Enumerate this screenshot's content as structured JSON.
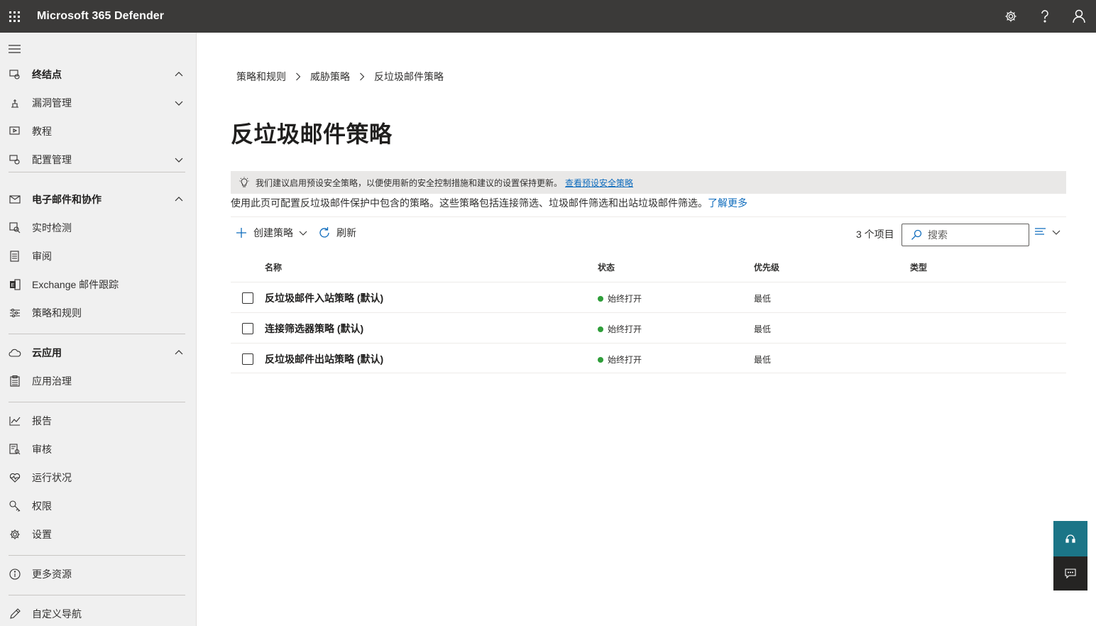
{
  "header": {
    "app_title": "Microsoft 365 Defender",
    "icons": [
      "waffle-icon",
      "settings-icon",
      "help-icon",
      "account-icon"
    ]
  },
  "sidebar": {
    "items": [
      {
        "label": "终结点",
        "icon": "endpoints-icon",
        "chevron": "up",
        "bold": true
      },
      {
        "label": "漏洞管理",
        "icon": "vulnerability-icon",
        "chevron": "down"
      },
      {
        "label": "教程",
        "icon": "tutorials-icon"
      },
      {
        "label": "配置管理",
        "icon": "config-icon",
        "chevron": "down"
      },
      {
        "label": "电子邮件和协作",
        "icon": "mail-icon",
        "chevron": "up",
        "bold": true
      },
      {
        "label": "实时检测",
        "icon": "realtime-icon"
      },
      {
        "label": "审阅",
        "icon": "review-icon"
      },
      {
        "label": "Exchange 邮件跟踪",
        "icon": "exchange-icon"
      },
      {
        "label": "策略和规则",
        "icon": "policies-icon"
      },
      {
        "label": "云应用",
        "icon": "cloud-icon",
        "chevron": "up",
        "bold": true
      },
      {
        "label": "应用治理",
        "icon": "app-governance-icon"
      },
      {
        "label": "报告",
        "icon": "reports-icon"
      },
      {
        "label": "审核",
        "icon": "audit-icon"
      },
      {
        "label": "运行状况",
        "icon": "health-icon"
      },
      {
        "label": "权限",
        "icon": "permissions-icon"
      },
      {
        "label": "设置",
        "icon": "settings-icon"
      },
      {
        "label": "更多资源",
        "icon": "info-icon"
      },
      {
        "label": "自定义导航",
        "icon": "edit-icon"
      }
    ]
  },
  "breadcrumb": [
    "策略和规则",
    "威胁策略",
    "反垃圾邮件策略"
  ],
  "page_title": "反垃圾邮件策略",
  "banner": {
    "text": "我们建议启用预设安全策略，以便使用新的安全控制措施和建议的设置保持更新。",
    "link": "查看预设安全策略"
  },
  "description": {
    "text": "使用此页可配置反垃圾邮件保护中包含的策略。这些策略包括连接筛选、垃圾邮件筛选和出站垃圾邮件筛选。",
    "link": "了解更多"
  },
  "toolbar": {
    "create_label": "创建策略",
    "refresh_label": "刷新",
    "count": "3 个项目",
    "search_placeholder": "搜索"
  },
  "table": {
    "columns": [
      "名称",
      "状态",
      "优先级",
      "类型"
    ],
    "rows": [
      {
        "name": "反垃圾邮件入站策略 (默认)",
        "status": "始终打开",
        "priority": "最低",
        "type": ""
      },
      {
        "name": "连接筛选器策略 (默认)",
        "status": "始终打开",
        "priority": "最低",
        "type": ""
      },
      {
        "name": "反垃圾邮件出站策略 (默认)",
        "status": "始终打开",
        "priority": "最低",
        "type": ""
      }
    ]
  },
  "colors": {
    "topbar": "#3b3a39",
    "sidebar": "#f0f0f0",
    "link": "#0f6cbd",
    "status_on": "#2f9e3a",
    "help_button": "#1b7587"
  }
}
